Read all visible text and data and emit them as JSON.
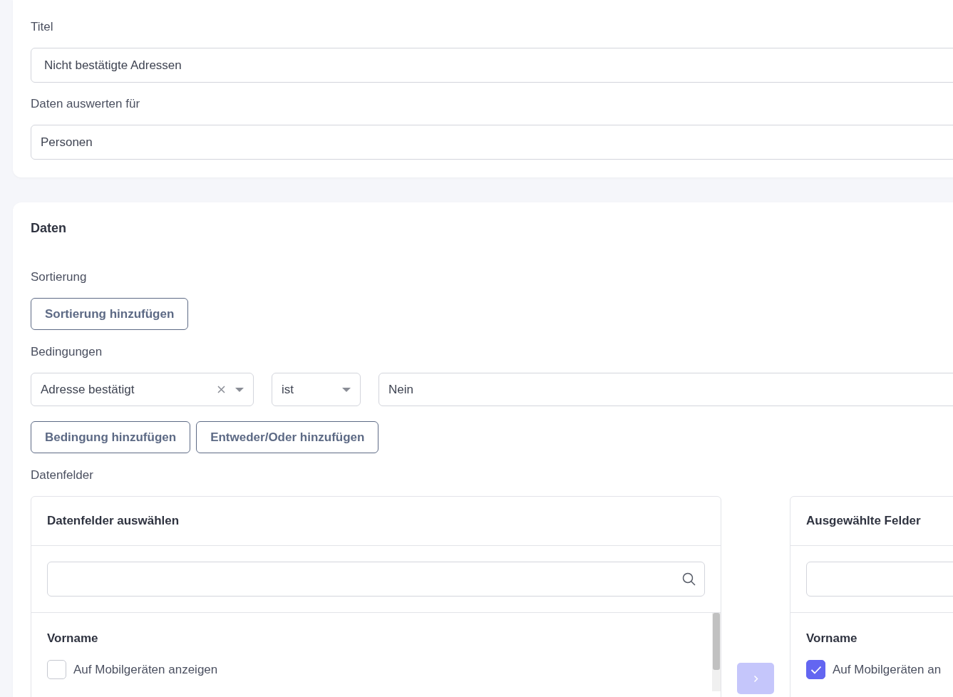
{
  "general": {
    "fields": [
      {
        "label": "Titel",
        "value": "Nicht bestätigte Adressen"
      },
      {
        "label": "Daten auswerten für",
        "value": "Personen"
      }
    ]
  },
  "data_section": {
    "title": "Daten",
    "sorting": {
      "label": "Sortierung",
      "button": "Sortierung hinzufügen"
    },
    "conditions": {
      "label": "Bedingungen",
      "rows": [
        {
          "field": "Adresse bestätigt",
          "operator": "ist",
          "value": "Nein"
        }
      ],
      "buttons": [
        "Bedingung hinzufügen",
        "Entweder/Oder hinzufügen"
      ]
    },
    "data_fields": {
      "label": "Datenfelder",
      "available": {
        "title": "Datenfelder auswählen",
        "items": [
          {
            "name": "Vorname",
            "option": "Auf Mobilgeräten anzeigen",
            "checked": false
          }
        ]
      },
      "move_button": {
        "disabled": true
      },
      "selected": {
        "title": "Ausgewählte Felder",
        "items": [
          {
            "name": "Vorname",
            "option": "Auf Mobilgeräten an",
            "checked": true
          }
        ]
      }
    }
  }
}
